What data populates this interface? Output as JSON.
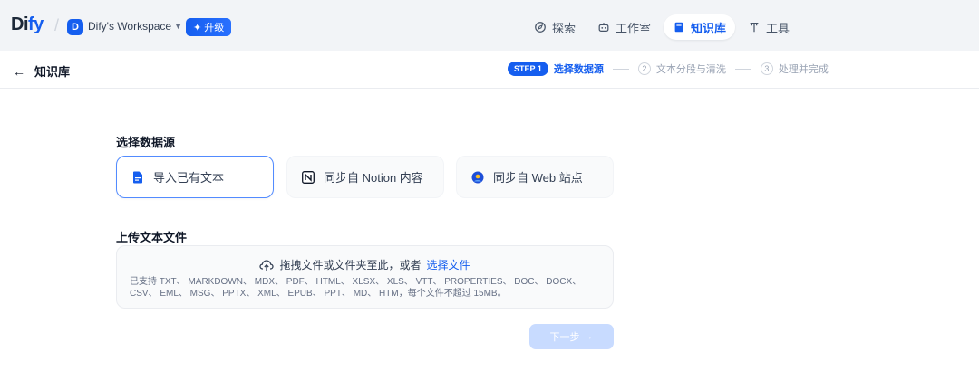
{
  "header": {
    "logo": {
      "part1": "Di",
      "part2": "fy"
    },
    "workspace": {
      "initial": "D",
      "name": "Dify's Workspace"
    },
    "upgrade_label": "升级",
    "nav": [
      {
        "label": "探索",
        "icon": "compass-icon",
        "active": false
      },
      {
        "label": "工作室",
        "icon": "robot-icon",
        "active": false
      },
      {
        "label": "知识库",
        "icon": "book-icon",
        "active": true
      },
      {
        "label": "工具",
        "icon": "tools-icon",
        "active": false
      }
    ]
  },
  "subheader": {
    "back_label": "知识库",
    "steps": {
      "active_pill": "STEP 1",
      "active_label": "选择数据源",
      "step2_num": "2",
      "step2_label": "文本分段与清洗",
      "step3_num": "3",
      "step3_label": "处理并完成"
    }
  },
  "main": {
    "source_title": "选择数据源",
    "sources": [
      {
        "label": "导入已有文本",
        "icon": "document-icon",
        "selected": true
      },
      {
        "label": "同步自 Notion 内容",
        "icon": "notion-icon",
        "selected": false
      },
      {
        "label": "同步自 Web 站点",
        "icon": "web-icon",
        "selected": false
      }
    ],
    "upload_title": "上传文本文件",
    "dropzone": {
      "text": "拖拽文件或文件夹至此，或者",
      "link": "选择文件",
      "help": "已支持 TXT、 MARKDOWN、 MDX、 PDF、 HTML、 XLSX、 XLS、 VTT、 PROPERTIES、 DOC、 DOCX、 CSV、 EML、 MSG、 PPTX、 XML、 EPUB、 PPT、 MD、 HTM，每个文件不超过 15MB。"
    },
    "next_label": "下一步"
  },
  "colors": {
    "accent": "#155eef",
    "topbar_bg": "#f2f4f7",
    "disabled_button": "#b2ccff"
  }
}
